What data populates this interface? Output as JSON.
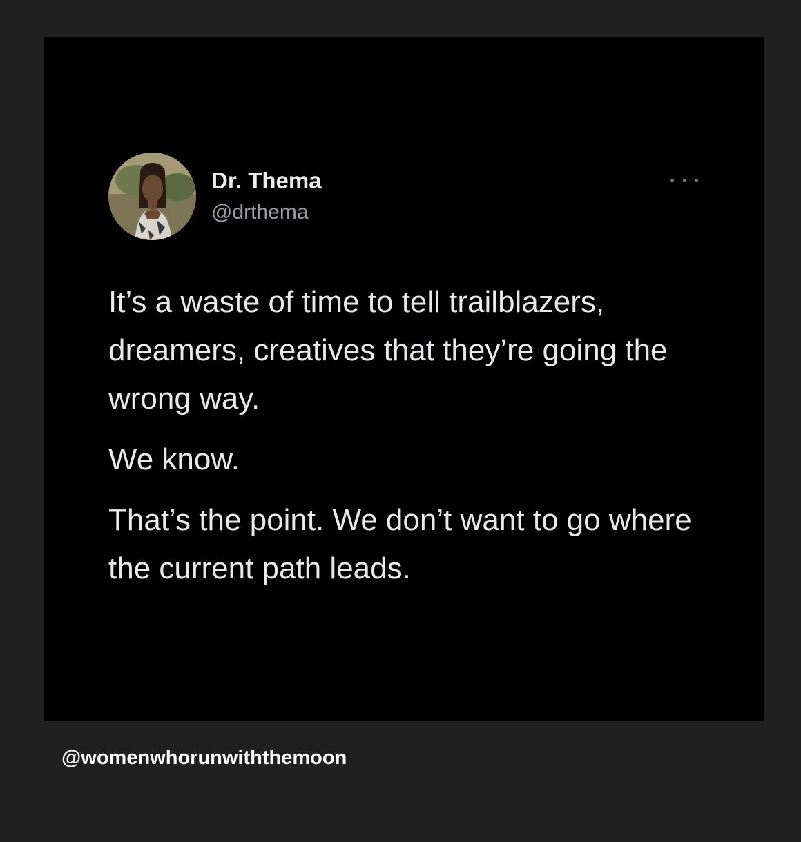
{
  "tweet": {
    "author_name": "Dr. Thema",
    "author_handle": "@drthema",
    "avatar_icon": "profile-photo",
    "more_icon": "ellipsis-icon",
    "paragraphs": [
      "It’s a waste of time to tell trailblazers, dreamers, creatives that they’re going the wrong way.",
      "We know.",
      "That’s the point. We don’t want to go where the current path leads."
    ]
  },
  "footer": {
    "handle": "@womenwhorunwiththemoon"
  },
  "colors": {
    "page_background": "#202020",
    "card_background": "#000000",
    "primary_text": "#e7e9ea",
    "secondary_text": "#9a9ea3"
  }
}
